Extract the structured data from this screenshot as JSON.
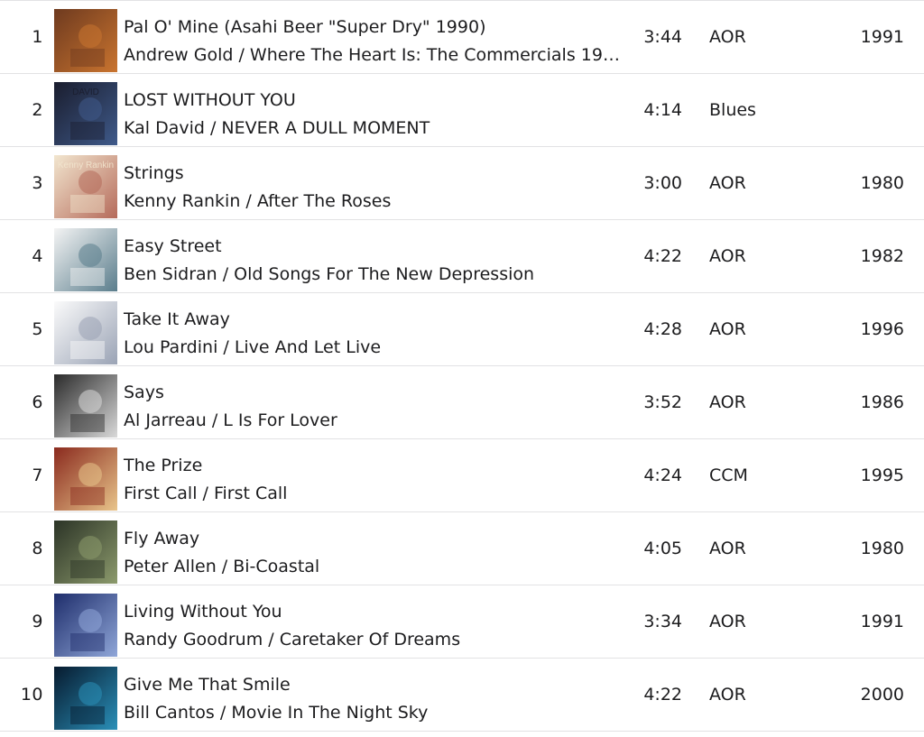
{
  "tracks": [
    {
      "number": "1",
      "title": "Pal O' Mine (Asahi Beer \"Super Dry\" 1990)",
      "subtitle": "Andrew Gold / Where The Heart Is: The Commercials 19…",
      "duration": "3:44",
      "genre": "AOR",
      "year": "1991",
      "art_colors": [
        "#6e3a1f",
        "#c9742f"
      ]
    },
    {
      "number": "2",
      "title": "LOST WITHOUT YOU",
      "subtitle": "Kal David / NEVER A DULL MOMENT",
      "duration": "4:14",
      "genre": "Blues",
      "year": "",
      "art_colors": [
        "#1a1d2e",
        "#3f5a8a"
      ],
      "art_text": "DAVID"
    },
    {
      "number": "3",
      "title": "Strings",
      "subtitle": "Kenny Rankin / After The Roses",
      "duration": "3:00",
      "genre": "AOR",
      "year": "1980",
      "art_colors": [
        "#f2e6cf",
        "#b56a5a"
      ],
      "art_text": "Kenny Rankin"
    },
    {
      "number": "4",
      "title": "Easy Street",
      "subtitle": "Ben Sidran / Old Songs For The New Depression",
      "duration": "4:22",
      "genre": "AOR",
      "year": "1982",
      "art_colors": [
        "#f4f4f4",
        "#5a7d8c"
      ]
    },
    {
      "number": "5",
      "title": "Take It Away",
      "subtitle": "Lou Pardini / Live And Let Live",
      "duration": "4:28",
      "genre": "AOR",
      "year": "1996",
      "art_colors": [
        "#fbfbfb",
        "#9aa3b5"
      ]
    },
    {
      "number": "6",
      "title": "Says",
      "subtitle": "Al Jarreau / L Is For Lover",
      "duration": "3:52",
      "genre": "AOR",
      "year": "1986",
      "art_colors": [
        "#2a2a2a",
        "#d9d9d9"
      ]
    },
    {
      "number": "7",
      "title": "The Prize",
      "subtitle": "First Call / First Call",
      "duration": "4:24",
      "genre": "CCM",
      "year": "1995",
      "art_colors": [
        "#8a2a1e",
        "#e8c48a"
      ]
    },
    {
      "number": "8",
      "title": "Fly Away",
      "subtitle": "Peter Allen / Bi-Coastal",
      "duration": "4:05",
      "genre": "AOR",
      "year": "1980",
      "art_colors": [
        "#2b3326",
        "#8c9a6c"
      ]
    },
    {
      "number": "9",
      "title": "Living Without You",
      "subtitle": "Randy Goodrum / Caretaker Of Dreams",
      "duration": "3:34",
      "genre": "AOR",
      "year": "1991",
      "art_colors": [
        "#1e2d6b",
        "#8fa6d8"
      ]
    },
    {
      "number": "10",
      "title": "Give Me That Smile",
      "subtitle": "Bill Cantos / Movie In The Night Sky",
      "duration": "4:22",
      "genre": "AOR",
      "year": "2000",
      "art_colors": [
        "#071a2e",
        "#2a8fb8"
      ]
    }
  ]
}
